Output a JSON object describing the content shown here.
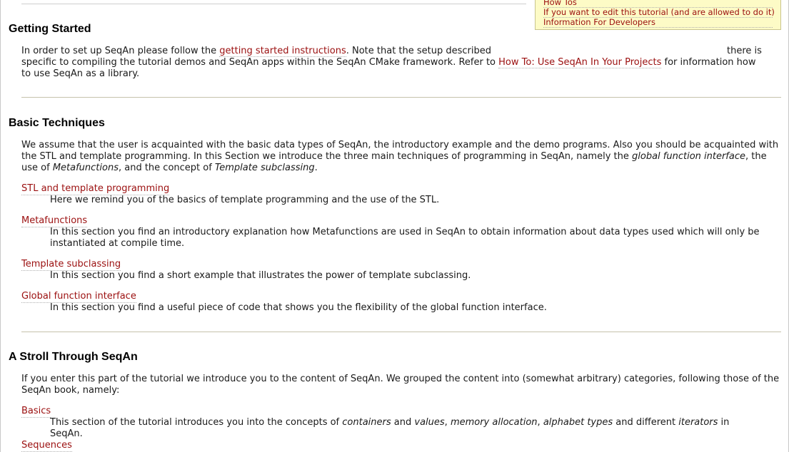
{
  "toc": {
    "how_tos": "How Tos",
    "edit_tutorial": "If you want to edit this tutorial (and are allowed to do it)",
    "developers": "Information For Developers"
  },
  "getting_started": {
    "heading": "Getting Started",
    "text_1": "In order to set up SeqAn please follow the ",
    "link_1": "getting started instructions",
    "text_2": ". Note that the setup described",
    "text_3": "there is specific to compiling the tutorial demos and SeqAn apps within the SeqAn CMake framework. Refer to ",
    "link_2": "How To: Use SeqAn In Your Projects",
    "text_4": " for information how to use SeqAn as a library."
  },
  "basic_techniques": {
    "heading": "Basic Techniques",
    "intro_1": "We assume that the user is acquainted with the basic data types of SeqAn, the introductory example and the demo programs. Also you should be acquainted with the STL and template programming. In this Section we introduce the three main techniques of programming in SeqAn, namely the ",
    "intro_em_1": "global function interface",
    "intro_2": ", the use of ",
    "intro_em_2": "Metafunctions",
    "intro_3": ", and the concept of ",
    "intro_em_3": "Template subclassing",
    "intro_4": ".",
    "items": [
      {
        "title": "STL and template programming",
        "desc": "Here we remind you of the basics of template programming and the use of the STL."
      },
      {
        "title": "Metafunctions",
        "desc": "In this section you find an introductory explanation how Metafunctions are used in SeqAn to obtain information about data types used which will only be instantiated at compile time."
      },
      {
        "title": "Template subclassing",
        "desc": "In this section you find a short example that illustrates the power of template subclassing."
      },
      {
        "title": "Global function interface",
        "desc": "In this section you find a useful piece of code that shows you the flexibility of the global function interface."
      }
    ]
  },
  "stroll": {
    "heading": "A Stroll Through SeqAn",
    "intro": "If you enter this part of the tutorial we introduce you to the content of SeqAn. We grouped the content into (somewhat arbitrary) categories, following those of the SeqAn book, namely:",
    "basics_title": "Basics",
    "basics_1": "This section of the tutorial introduces you into the concepts of ",
    "basics_em_1": "containers",
    "basics_2": " and ",
    "basics_em_2": "values",
    "basics_3": ", ",
    "basics_em_3": "memory allocation",
    "basics_4": ", ",
    "basics_em_4": "alphabet types",
    "basics_5": " and different ",
    "basics_em_5": "iterators",
    "basics_6": " in SeqAn.",
    "sequences_title": "Sequences"
  }
}
